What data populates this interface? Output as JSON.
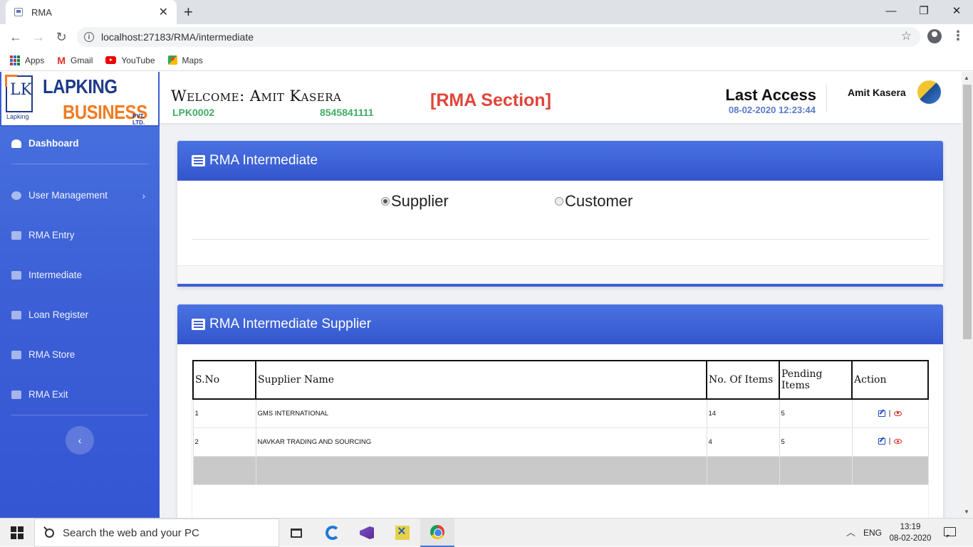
{
  "browser": {
    "tab_title": "RMA",
    "tab_close": "✕",
    "new_tab": "+",
    "url": "localhost:27183/RMA/intermediate",
    "window_controls": {
      "minimize": "—",
      "maximize": "❐",
      "close": "✕"
    },
    "bookmarks": [
      {
        "label": "Apps",
        "icon": "apps-grid-icon"
      },
      {
        "label": "Gmail",
        "icon": "gmail-icon"
      },
      {
        "label": "YouTube",
        "icon": "youtube-icon"
      },
      {
        "label": "Maps",
        "icon": "maps-icon"
      }
    ]
  },
  "brand": {
    "logo_letters": "LK",
    "logo_caption": "Lapking",
    "name_line1": "LAPKING",
    "name_line2": "BUSINESS",
    "suffix": "PVT. LTD."
  },
  "sidebar": {
    "items": [
      {
        "label": "Dashboard",
        "icon": "dashboard-icon",
        "active": true
      },
      {
        "label": "User Management",
        "icon": "gear-icon",
        "has_submenu": true
      },
      {
        "label": "RMA Entry",
        "icon": "list-icon"
      },
      {
        "label": "Intermediate",
        "icon": "briefcase-icon"
      },
      {
        "label": "Loan Register",
        "icon": "list-icon"
      },
      {
        "label": "RMA Store",
        "icon": "store-icon"
      },
      {
        "label": "RMA Exit",
        "icon": "list-icon"
      }
    ],
    "collapse_symbol": "‹"
  },
  "header": {
    "welcome": "Welcome: Amit Kasera",
    "user_id": "LPK0002",
    "phone": "8545841111",
    "section": "[RMA Section]",
    "last_access_label": "Last Access",
    "last_access_time": "08-02-2020 12:23:44",
    "user_name": "Amit Kasera"
  },
  "intermediate_card": {
    "title": "RMA Intermediate",
    "options": [
      {
        "label": "Supplier",
        "selected": true
      },
      {
        "label": "Customer",
        "selected": false
      }
    ]
  },
  "supplier_card": {
    "title": "RMA Intermediate Supplier",
    "columns": [
      "S.No",
      "Supplier Name",
      "No. Of Items",
      "Pending Items",
      "Action"
    ],
    "rows": [
      {
        "sno": "1",
        "supplier": "GMS INTERNATIONAL",
        "items": "14",
        "pending": "5",
        "sep": "|"
      },
      {
        "sno": "2",
        "supplier": "NAVKAR TRADING AND SOURCING",
        "items": "4",
        "pending": "5",
        "sep": "|"
      }
    ]
  },
  "taskbar": {
    "search_placeholder": "Search the web and your PC",
    "language": "ENG",
    "time": "13:19",
    "date": "08-02-2020"
  },
  "colors": {
    "accent_blue": "#3c5fd6",
    "section_red": "#e0453a",
    "id_green": "#3fae64",
    "brand_orange": "#f07c22"
  }
}
